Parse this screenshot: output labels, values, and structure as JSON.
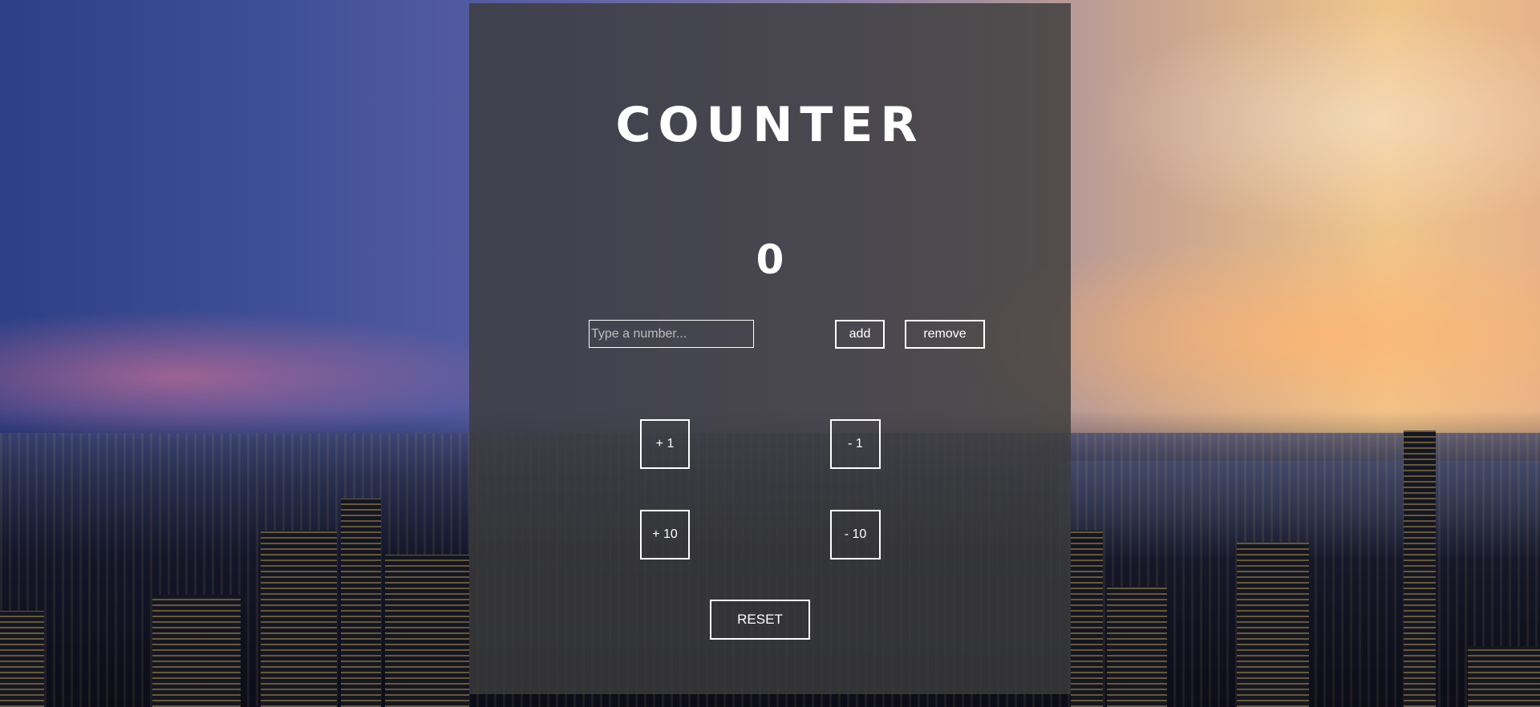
{
  "counter": {
    "title": "COUNTER",
    "value": "0"
  },
  "input": {
    "placeholder": "Type a number...",
    "value": ""
  },
  "buttons": {
    "add": "add",
    "remove": "remove",
    "plus_one": "+ 1",
    "minus_one": "- 1",
    "plus_ten": "+ 10",
    "minus_ten": "- 10",
    "reset": "RESET"
  },
  "theme": {
    "panel_color": "#3c3c3c",
    "text_color": "#ffffff",
    "border_color": "#ffffff"
  },
  "background": {
    "subject": "city-skyline-at-dusk"
  }
}
